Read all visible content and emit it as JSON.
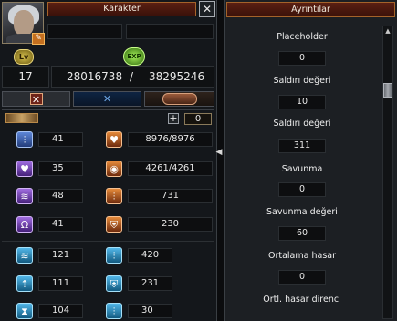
{
  "character_window": {
    "title": "Karakter",
    "close_label": "✕",
    "level_badge": "Lv",
    "exp_badge": "EXP",
    "level": "17",
    "exp_current": "28016738",
    "exp_separator": "/",
    "exp_max": "38295246",
    "stat_points": "0",
    "plus_label": "+"
  },
  "stats": {
    "str": "41",
    "hp": "8976/8976",
    "vit": "35",
    "sp": "4261/4261",
    "dex": "48",
    "attack": "731",
    "int": "41",
    "defense": "230",
    "move_speed": "121",
    "attack_speed": "420",
    "magic_attack": "111",
    "magic_defense": "231",
    "cast_speed": "104",
    "dodge": "30"
  },
  "details_window": {
    "title": "Ayrıntılar",
    "rows": [
      {
        "label": "Placeholder",
        "value": "0"
      },
      {
        "label": "Saldırı değeri",
        "value": "10"
      },
      {
        "label": "Saldırı değeri",
        "value": "311"
      },
      {
        "label": "Savunma",
        "value": "0"
      },
      {
        "label": "Savunma değeri",
        "value": "60"
      },
      {
        "label": "Ortalama hasar",
        "value": "0"
      },
      {
        "label": "Ortl. hasar direnci",
        "value": ""
      }
    ]
  },
  "colors": {
    "title_bar": "#5a1f12",
    "panel_bg": "#14171b",
    "detail_bg": "#1c1f23"
  }
}
